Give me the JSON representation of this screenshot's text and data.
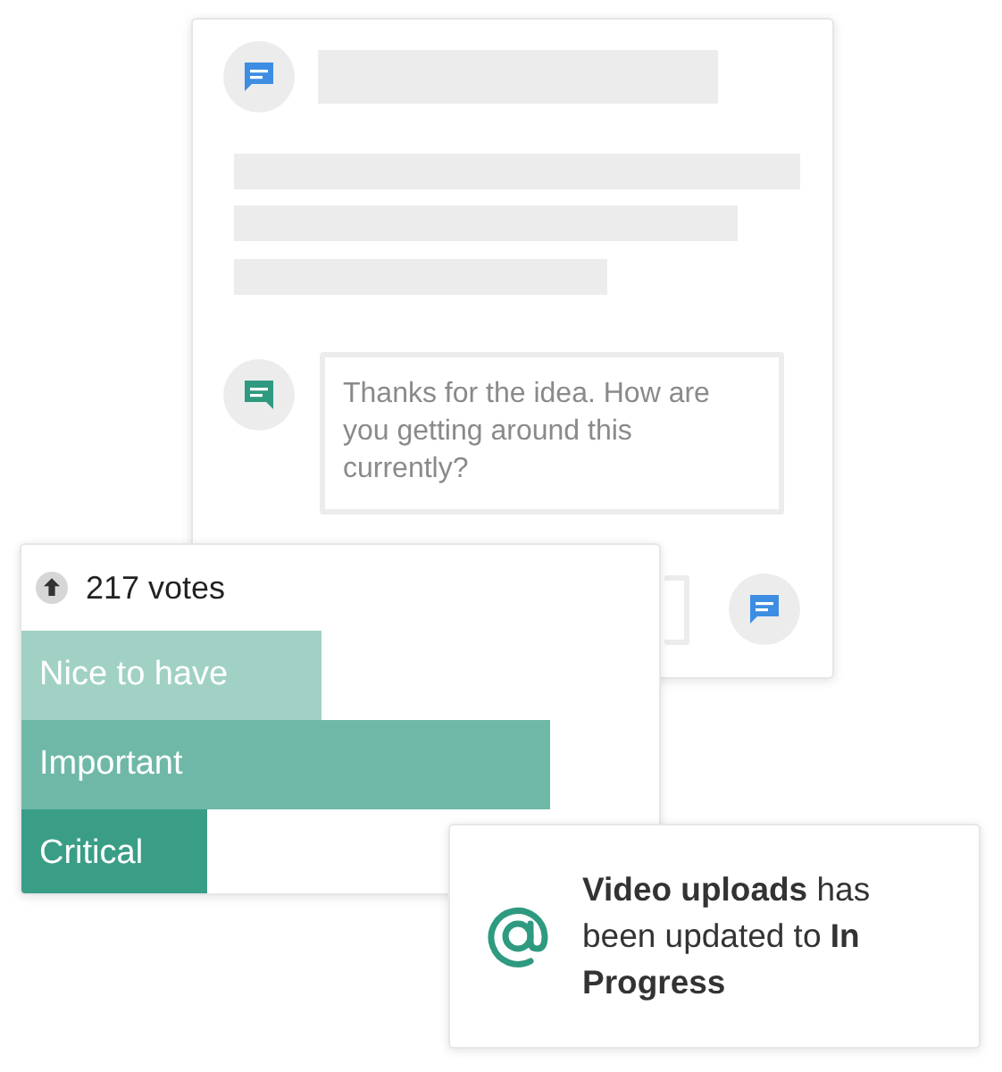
{
  "message_card": {
    "comment": "Thanks for the idea. How are you getting around this currently?"
  },
  "votes": {
    "count_label": "217 votes",
    "bars": [
      {
        "label": "Nice to have",
        "level": 0.47,
        "color": "#a0d1c4"
      },
      {
        "label": "Important",
        "level": 0.83,
        "color": "#6fb8a7"
      },
      {
        "label": "Critical",
        "level": 0.29,
        "color": "#3a9e87"
      }
    ]
  },
  "notification": {
    "text": "**Video uploads** has been updated to **In Progress**"
  }
}
